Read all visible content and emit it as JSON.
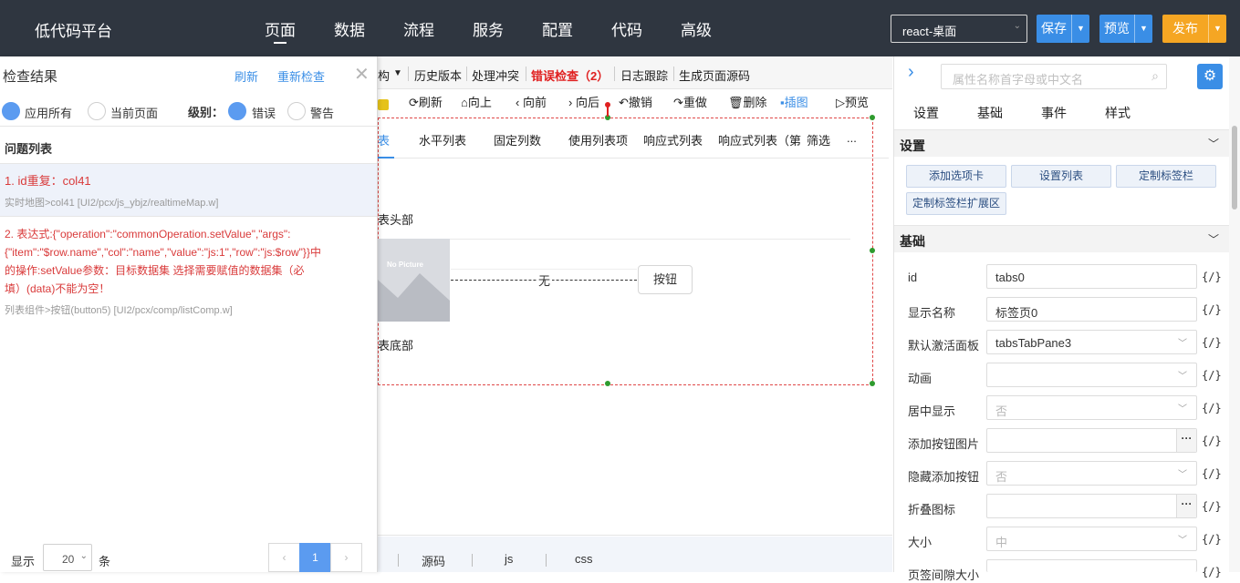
{
  "brand": "低代码平台",
  "nav": [
    "页面",
    "数据",
    "流程",
    "服务",
    "配置",
    "代码",
    "高级"
  ],
  "topbar": {
    "env": "react-桌面",
    "save": "保存",
    "preview": "预览",
    "publish": "发布"
  },
  "check_panel": {
    "title": "检查结果",
    "refresh": "刷新",
    "recheck": "重新检查",
    "scope_all": "应用所有",
    "scope_current": "当前页面",
    "level_label": "级别：",
    "level_error": "错误",
    "level_warn": "警告",
    "issues_title": "问题列表",
    "issues": [
      {
        "text": "1. id重复：col41",
        "source": "实时地图>col41 [UI2/pcx/js_ybjz/realtimeMap.w]"
      },
      {
        "lines": [
          "2. 表达式:{\"operation\":\"commonOperation.setValue\",\"args\":",
          "{\"item\":\"$row.name\",\"col\":\"name\",\"value\":\"js:1\",\"row\":\"js:$row\"}}中",
          "的操作:setValue参数：目标数据集 选择需要赋值的数据集（必",
          "填）(data)不能为空！"
        ],
        "source": "列表组件>按钮(button5) [UI2/pcx/comp/listComp.w]"
      }
    ],
    "pager": {
      "show": "显示",
      "size": "20",
      "unit": "条",
      "prev": "‹",
      "page": "1",
      "next": "›"
    }
  },
  "toolbar1": [
    "构",
    "历史版本",
    "处理冲突",
    "错误检查（2）",
    "日志跟踪",
    "生成页面源码"
  ],
  "toolbar2": [
    "刷新",
    "向上",
    "向前",
    "向后",
    "撤销",
    "重做",
    "删除",
    "插图",
    "预览"
  ],
  "canvas": {
    "tabs": [
      "表",
      "水平列表",
      "固定列数",
      "使用列表项",
      "响应式列表",
      "响应式列表（第",
      "筛选",
      "..."
    ],
    "list_head": "表头部",
    "placeholder_img": "No Picture",
    "none_text": "无",
    "button": "按钮",
    "list_foot": "表底部"
  },
  "bottom_tabs": [
    "源码",
    "js",
    "css"
  ],
  "props": {
    "search_placeholder": "属性名称首字母或中文名",
    "tabs": [
      "设置",
      "基础",
      "事件",
      "样式"
    ],
    "sec_settings": "设置",
    "buttons": [
      "添加选项卡",
      "设置列表",
      "定制标签栏",
      "定制标签栏扩展区"
    ],
    "sec_basic": "基础",
    "fx": "{/}",
    "fields": [
      {
        "label": "id",
        "value": "tabs0"
      },
      {
        "label": "显示名称",
        "value": "标签页0"
      },
      {
        "label": "默认激活面板",
        "value": "tabsTabPane3"
      },
      {
        "label": "动画",
        "value": ""
      },
      {
        "label": "居中显示",
        "value": "否"
      },
      {
        "label": "添加按钮图片",
        "value": ""
      },
      {
        "label": "隐藏添加按钮",
        "value": "否"
      },
      {
        "label": "折叠图标",
        "value": ""
      },
      {
        "label": "大小",
        "value": "中"
      },
      {
        "label": "页签间隙大小",
        "value": ""
      }
    ]
  },
  "colors": {
    "accent": "#3a8ee6",
    "orange": "#f5a623",
    "error": "#e02020",
    "topbar": "#2f3640"
  }
}
